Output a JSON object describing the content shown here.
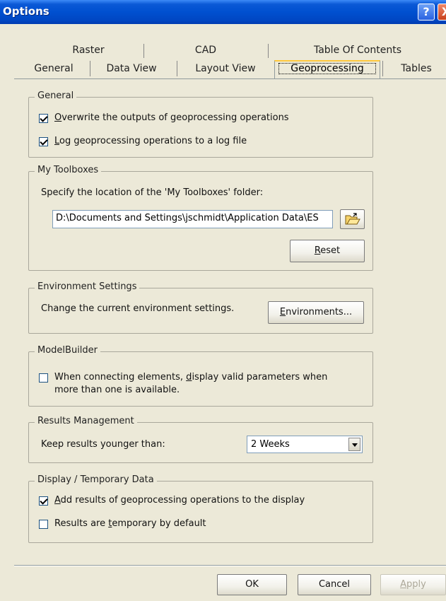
{
  "window": {
    "title": "Options",
    "help_glyph": "?",
    "close_glyph": "X"
  },
  "tabs": {
    "row1": [
      "Raster",
      "CAD",
      "Table Of Contents"
    ],
    "row2": [
      "General",
      "Data View",
      "Layout View",
      "Geoprocessing",
      "Tables"
    ],
    "active": "Geoprocessing"
  },
  "general": {
    "legend": "General",
    "overwrite": {
      "pre": "",
      "accel": "O",
      "post": "verwrite the outputs of geoprocessing operations",
      "checked": true
    },
    "log": {
      "pre": "",
      "accel": "L",
      "post": "og geoprocessing operations to a log file",
      "checked": true
    }
  },
  "toolboxes": {
    "legend": "My Toolboxes",
    "instruction": "Specify the location of the 'My Toolboxes' folder:",
    "path": "D:\\Documents and Settings\\jschmidt\\Application Data\\ES",
    "browse_icon": "open-folder-icon",
    "reset": {
      "accel": "R",
      "post": "eset"
    }
  },
  "environment": {
    "legend": "Environment Settings",
    "text": "Change the current environment settings.",
    "button": {
      "accel": "E",
      "post": "nvironments..."
    }
  },
  "modelbuilder": {
    "legend": "ModelBuilder",
    "line1_pre": "When connecting elements, ",
    "line1_accel": "d",
    "line1_post": "isplay valid parameters when",
    "line2": "more than one is available.",
    "checked": false
  },
  "results": {
    "legend": "Results Management",
    "label": "Keep results younger than:",
    "selected": "2 Weeks"
  },
  "display": {
    "legend": "Display / Temporary Data",
    "add": {
      "accel": "A",
      "post": "dd results of geoprocessing operations to the display",
      "checked": true
    },
    "temp": {
      "pre": "Results are ",
      "accel": "t",
      "post": "emporary by default",
      "checked": false
    }
  },
  "footer": {
    "ok": "OK",
    "cancel": "Cancel",
    "apply_accel": "A",
    "apply_post": "pply"
  }
}
